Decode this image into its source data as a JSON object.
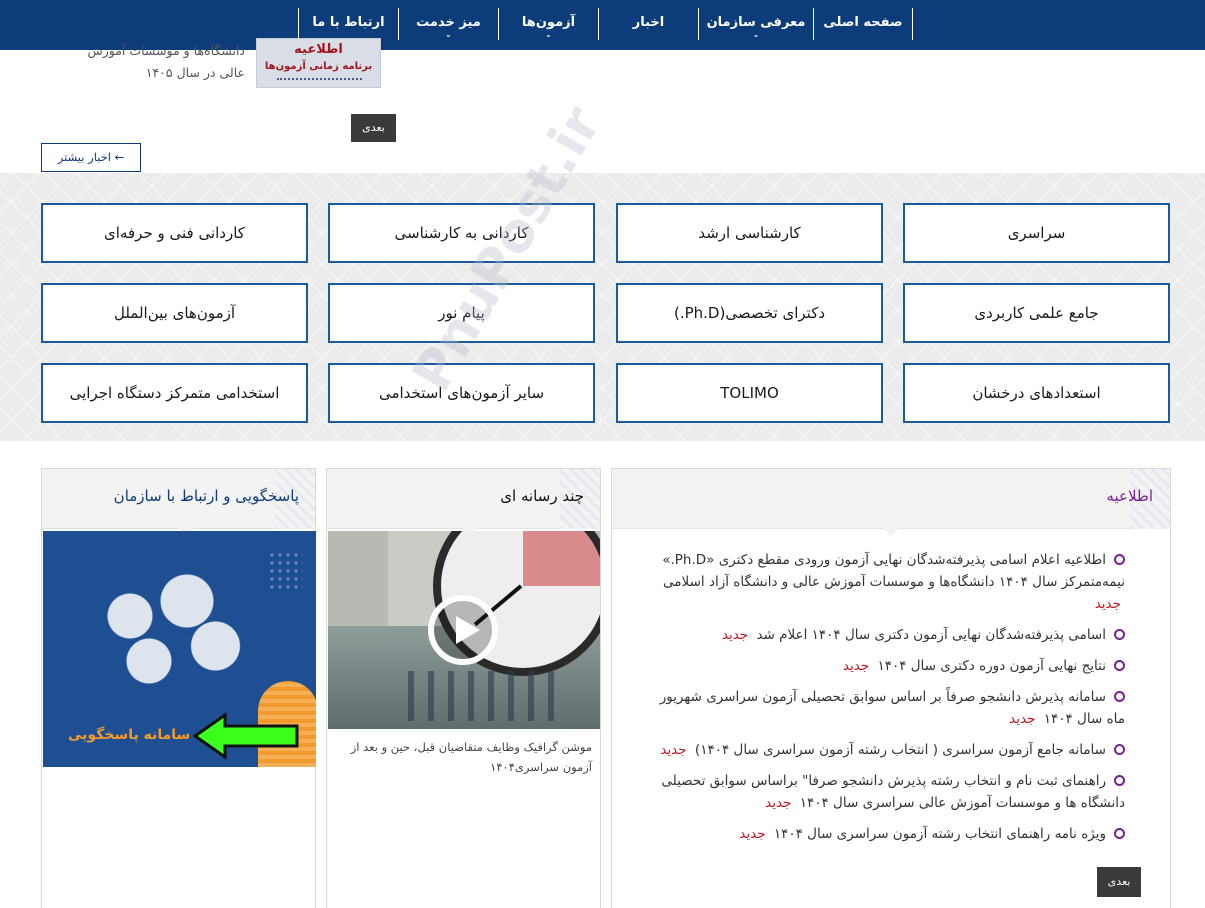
{
  "nav": {
    "items": [
      {
        "label": "صفحه اصلی",
        "dropdown": false
      },
      {
        "label": "معرفی سازمان",
        "dropdown": true
      },
      {
        "label": "اخبار",
        "dropdown": false
      },
      {
        "label": "آزمون‌ها",
        "dropdown": true
      },
      {
        "label": "میز خدمت",
        "dropdown": true
      },
      {
        "label": "ارتباط با ما",
        "dropdown": false
      }
    ]
  },
  "news": {
    "thumb_title": "اطلاعیه",
    "thumb_subtitle": "برنامه زمانی آزمون‌ها",
    "text_lines": [
      "دانشگاه‌ها و موسسات آموزش",
      "عالی در سال ۱۴۰۵"
    ],
    "next_label": "بعدی",
    "more_label": "اخبار بیشتر ←"
  },
  "exams": {
    "rows": [
      [
        "سراسری",
        "کارشناسی ارشد",
        "کاردانی به کارشناسی",
        "کاردانی فنی و حرفه‌ای"
      ],
      [
        "جامع علمی کاربردی",
        "دکترای تخصصی(Ph.D.)",
        "پیام نور",
        "آزمون‌های بین‌الملل"
      ],
      [
        "استعدادهای درخشان",
        "TOLIMO",
        "سایر آزمون‌های استخدامی",
        "استخدامی متمرکز دستگاه اجرایی"
      ]
    ]
  },
  "watermark": "PnuPost.ir",
  "notice": {
    "title": "اطلاعیه",
    "items": [
      {
        "text": "اطلاعیه اعلام اسامی پذیرفته‌شدگان نهایی آزمون ورودی مقطع دکتری «Ph.D.» نیمه‌متمرکز سال ۱۴۰۴ دانشگاه‌ها و موسسات آموزش عالی و دانشگاه آزاد اسلامی",
        "badge": "جدید"
      },
      {
        "text": "اسامی پذیرفته‌شدگان نهایی آزمون دکتری سال ۱۴۰۴ اعلام شد",
        "badge": "جدید"
      },
      {
        "text": "نتایج نهایی آزمون دوره دکتری سال ۱۴۰۴",
        "badge": "جدید"
      },
      {
        "text": "سامانه پذیرش دانشجو صرفاً بر اساس سوابق تحصیلی آزمون سراسری شهریور ماه سال ۱۴۰۴",
        "badge": "جدید"
      },
      {
        "text": "سامانه جامع آزمون سراسری ( انتخاب رشته آزمون سراسری سال ۱۴۰۴)",
        "badge": "جدید"
      },
      {
        "text": "راهنمای ثبت نام و انتخاب رشته پذیرش دانشجو صرفا\" براساس سوابق تحصیلی دانشگاه ها و موسسات آموزش عالی سراسری سال ۱۴۰۴",
        "badge": "جدید"
      },
      {
        "text": "ویژه نامه راهنمای انتخاب رشته آزمون سراسری سال ۱۴۰۴",
        "badge": "جدید"
      }
    ],
    "next_label": "بعدی"
  },
  "media": {
    "title": "چند رسانه ای",
    "caption": "موشن گرافیک وظایف متقاضیان قبل، حین و بعد از آزمون سراسری۱۴۰۴"
  },
  "contact": {
    "title": "پاسخگویی و ارتباط با سازمان",
    "banner_label": "سامانه پاسخگویی"
  },
  "colors": {
    "nav_bg": "#0d3c7b",
    "exam_border": "#1b5a9f",
    "notice_accent": "#7a1f8f",
    "new_badge": "#c0141c",
    "arrow_green": "#3cff1e"
  }
}
